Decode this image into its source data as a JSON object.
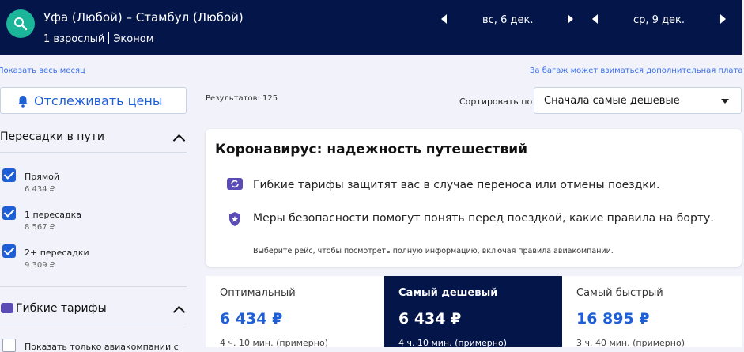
{
  "header": {
    "route": "Уфа (Любой) – Стамбул (Любой)",
    "passengers": "1 взрослый",
    "cabin": "Эконом",
    "depart_date": "вс, 6 дек.",
    "return_date": "ср, 9 дек."
  },
  "links": {
    "whole_month": "Показать весь месяц",
    "baggage_note": "За багаж может взиматься дополнительная плата"
  },
  "track_prices_label": "Отслеживать цены",
  "results_count": "Результатов: 125",
  "sort": {
    "label": "Сортировать по",
    "value": "Сначала самые дешевые"
  },
  "filters": {
    "stops": {
      "title": "Пересадки в пути",
      "options": [
        {
          "label": "Прямой",
          "price": "6 434 ₽",
          "checked": true
        },
        {
          "label": "1 пересадка",
          "price": "8 567 ₽",
          "checked": true
        },
        {
          "label": "2+ пересадки",
          "price": "9 309 ₽",
          "checked": true
        }
      ]
    },
    "flex": {
      "title": "Гибкие тарифы",
      "option_partial": "Показать только авиакомпании с"
    }
  },
  "covid_card": {
    "title": "Коронавирус: надежность путешествий",
    "line1": "Гибкие тарифы защитят вас в случае переноса или отмены поездки.",
    "line2": "Меры безопасности помогут понять перед поездкой, какие правила на борту.",
    "footnote": "Выберите рейс, чтобы посмотреть полную информацию, включая правила авиакомпании."
  },
  "sort_tabs": [
    {
      "name": "Оптимальный",
      "price": "6 434 ₽",
      "duration": "4 ч. 10 мин. (примерно)",
      "active": false
    },
    {
      "name": "Самый дешевый",
      "price": "6 434 ₽",
      "duration": "4 ч. 10 мин. (примерно)",
      "active": true
    },
    {
      "name": "Самый быстрый",
      "price": "16 895 ₽",
      "duration": "3 ч. 40 мин. (примерно)",
      "active": false
    }
  ],
  "colors": {
    "navy": "#04154a",
    "accent": "#1f5fd6",
    "teal": "#1bb59a",
    "purple": "#5b4bb5"
  }
}
